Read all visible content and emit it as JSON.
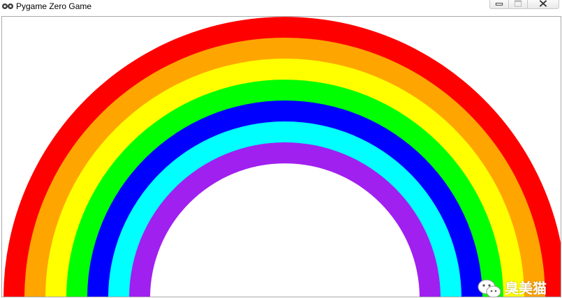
{
  "window": {
    "title": "Pygame Zero Game",
    "icon": "snake-icon",
    "controls": [
      "minimize-icon",
      "maximize-icon",
      "close-icon"
    ]
  },
  "canvas": {
    "background": "#ffffff",
    "rainbow_bands": [
      {
        "color": "#ff0000"
      },
      {
        "color": "#ffa500"
      },
      {
        "color": "#ffff00"
      },
      {
        "color": "#00ff00"
      },
      {
        "color": "#0000ff"
      },
      {
        "color": "#00ffff"
      },
      {
        "color": "#a020f0"
      }
    ]
  },
  "watermark": {
    "icon": "wechat-icon",
    "text": "臭美猫"
  }
}
